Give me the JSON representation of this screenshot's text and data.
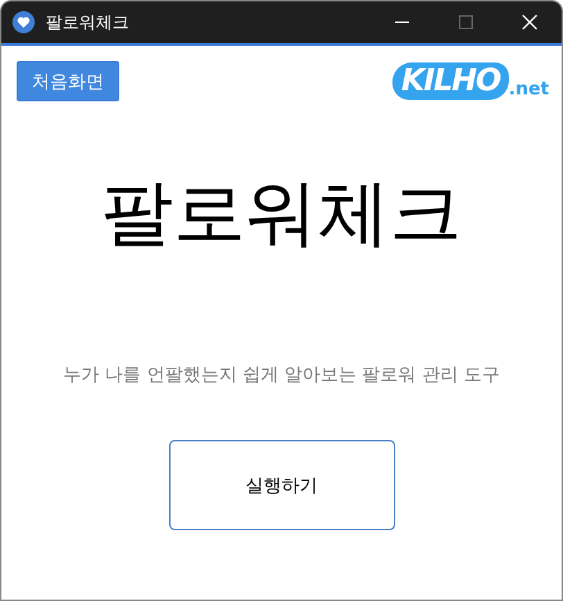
{
  "window": {
    "title": "팔로워체크"
  },
  "home_button": "처음화면",
  "logo": {
    "main": "KILHO",
    "suffix": ".net"
  },
  "heading": "팔로워체크",
  "subtitle": "누가 나를 언팔했는지 쉽게 알아보는 팔로워 관리 도구",
  "run_button": "실행하기"
}
